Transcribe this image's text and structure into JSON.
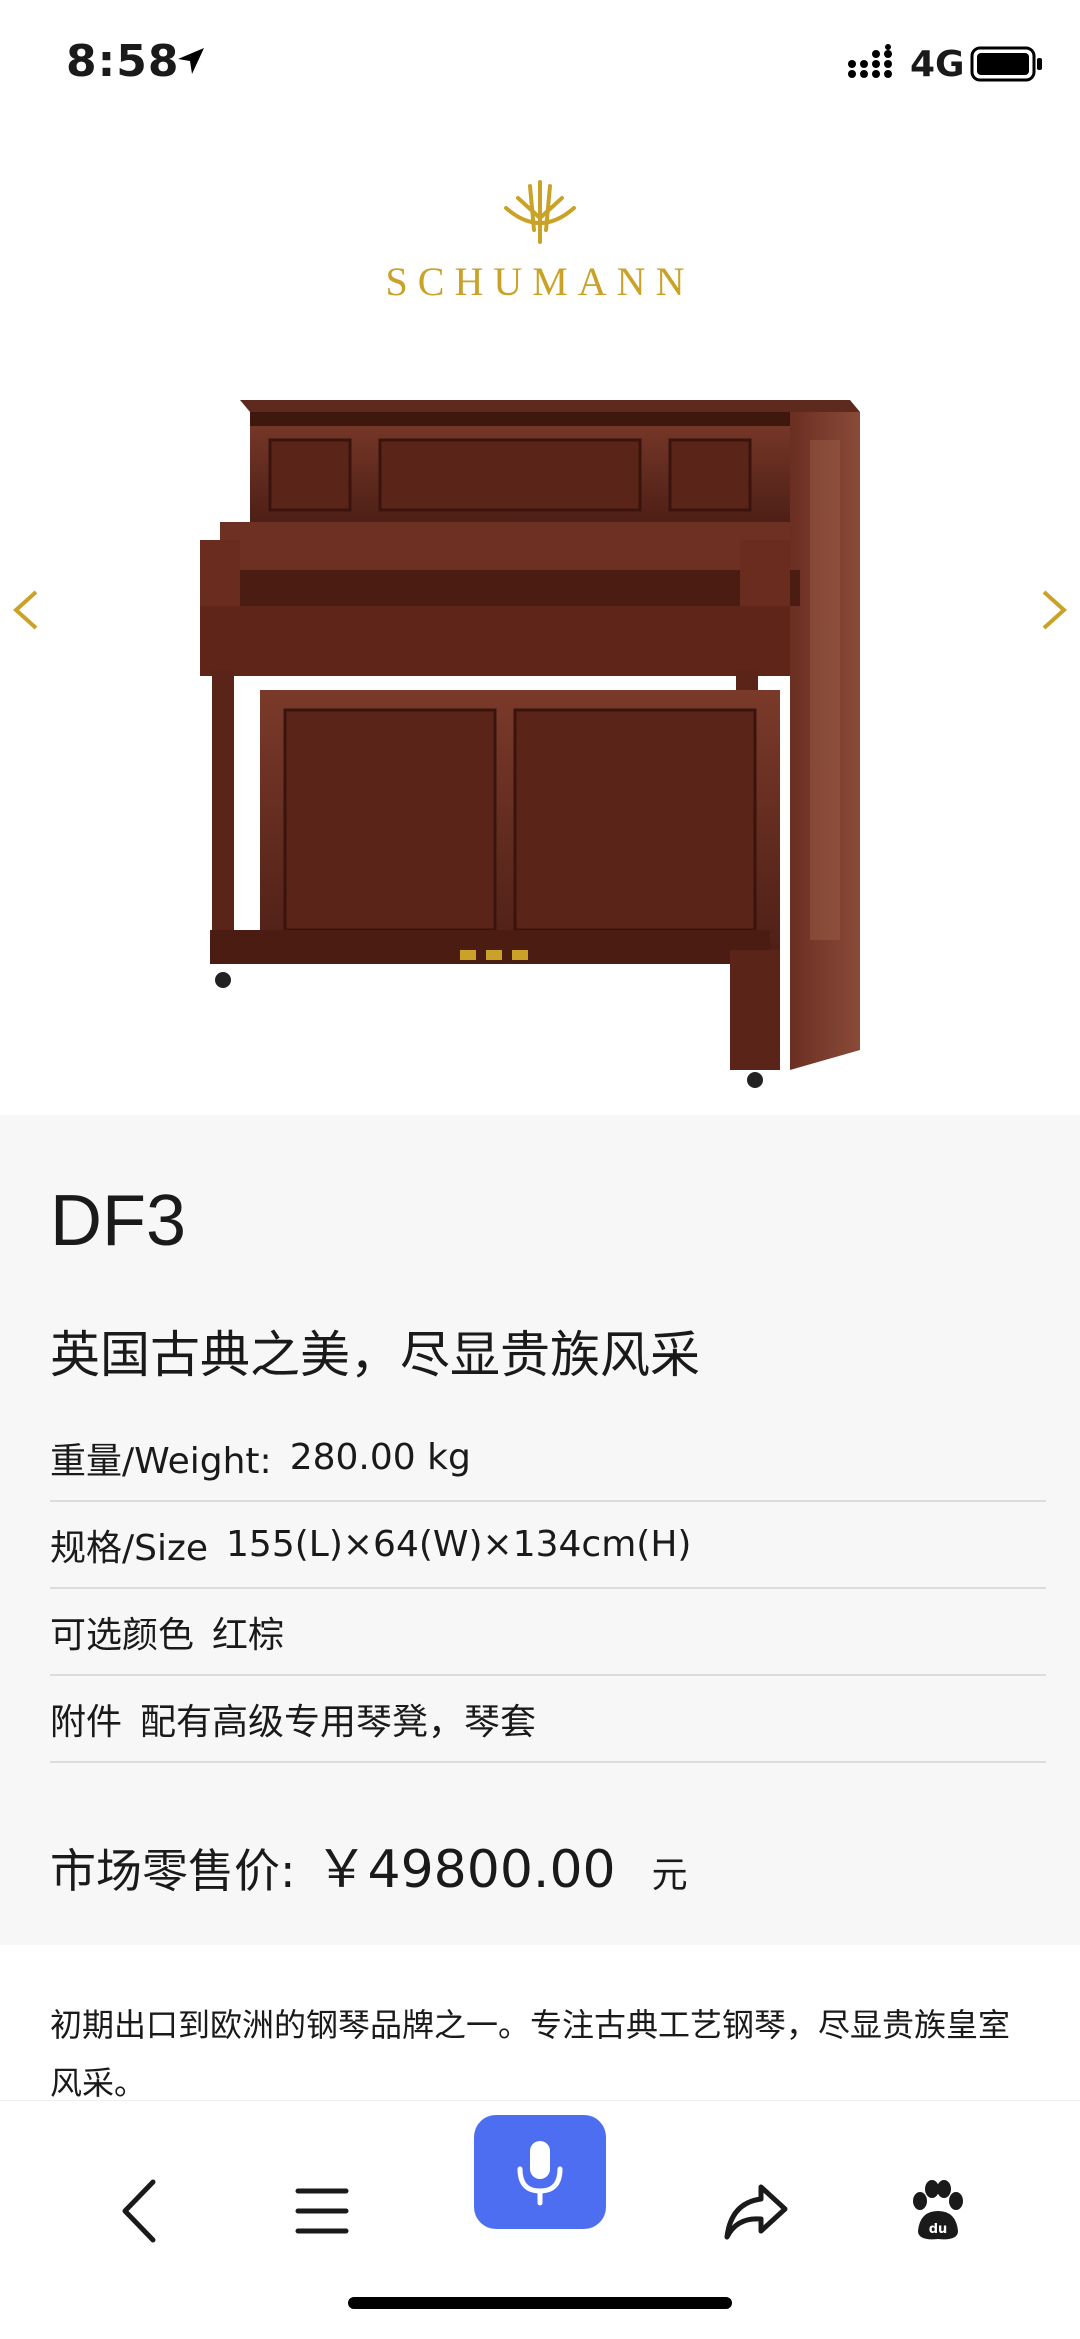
{
  "status_bar": {
    "time": "8:58",
    "network": "4G"
  },
  "hero": {
    "brand": "SCHUMANN",
    "brand_color": "#c9a227"
  },
  "product": {
    "model": "DF3",
    "slogan": "英国古典之美，尽显贵族风采",
    "specs": [
      {
        "label": "重量/Weight:",
        "value": "280.00 kg"
      },
      {
        "label": "规格/Size",
        "value": "155(L)×64(W)×134cm(H)"
      },
      {
        "label": "可选颜色",
        "value": "红棕"
      },
      {
        "label": "附件",
        "value": "配有高级专用琴凳，琴套"
      }
    ],
    "price_label": "市场零售价:",
    "price_value": "￥49800.00",
    "price_unit": "元"
  },
  "description": "初期出口到欧洲的钢琴品牌之一。专注古典工艺钢琴，尽显贵族皇室风采。",
  "bottom_bar": {
    "icons": [
      "back-icon",
      "menu-icon",
      "microphone-icon",
      "share-icon",
      "baidu-paw-icon"
    ],
    "accent": "#4e6ef2"
  }
}
